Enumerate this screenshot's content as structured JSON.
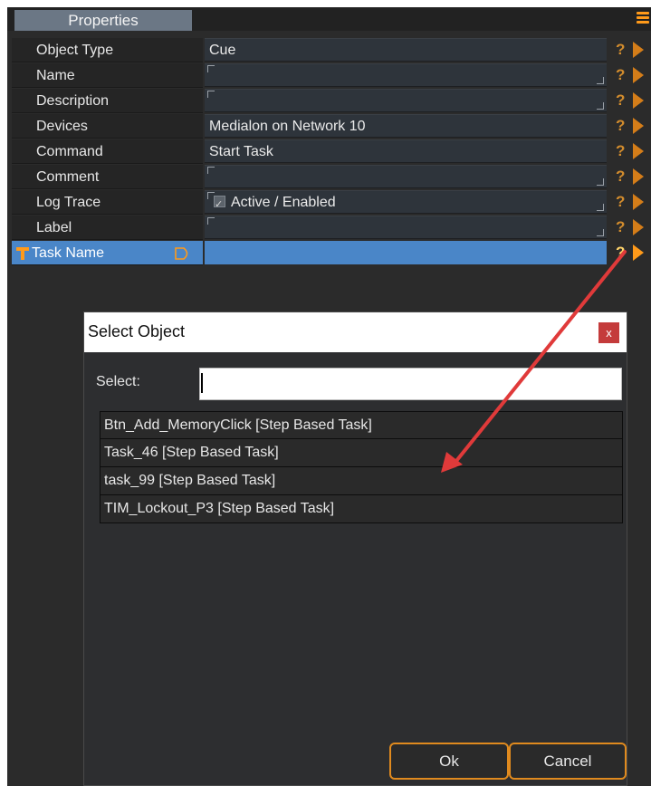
{
  "panel": {
    "tab_label": "Properties"
  },
  "properties": [
    {
      "name": "Object Type",
      "value": "Cue",
      "corners": false
    },
    {
      "name": "Name",
      "value": "",
      "corners": true
    },
    {
      "name": "Description",
      "value": "",
      "corners": true
    },
    {
      "name": "Devices",
      "value": "Medialon on Network  10",
      "corners": false
    },
    {
      "name": "Command",
      "value": "Start Task",
      "corners": false
    },
    {
      "name": "Comment",
      "value": "",
      "corners": true
    },
    {
      "name": "Log Trace",
      "value": "Active / Enabled",
      "corners": true
    },
    {
      "name": "Label",
      "value": "",
      "corners": true
    },
    {
      "name": "Task Name",
      "value": "",
      "corners": false
    }
  ],
  "row_help_glyph": "?",
  "dialog": {
    "title": "Select Object",
    "close_glyph": "x",
    "select_label": "Select:",
    "select_value": "",
    "items": [
      "Btn_Add_MemoryClick [Step Based Task]",
      "Task_46 [Step Based Task]",
      "task_99 [Step Based Task]",
      "TIM_Lockout_P3 [Step Based Task]"
    ],
    "ok_label": "Ok",
    "cancel_label": "Cancel"
  },
  "colors": {
    "accent": "#ff9a1a",
    "selection": "#4a86c8",
    "annotation_arrow": "#e03a3a",
    "close_button": "#c43b3b"
  },
  "icons": [
    "menu-icon",
    "help-icon",
    "play-arrow-icon",
    "text-type-icon",
    "tag-icon",
    "checkbox-icon"
  ]
}
